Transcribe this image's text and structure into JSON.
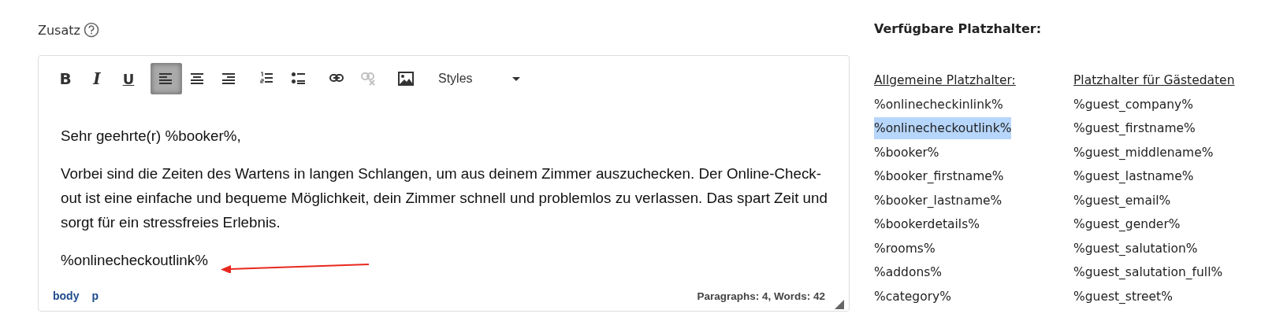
{
  "field": {
    "label": "Zusatz"
  },
  "toolbar": [
    {
      "kind": "bold",
      "label": "B",
      "selected": false,
      "disabled": false
    },
    {
      "kind": "italic",
      "label": "I",
      "selected": false,
      "disabled": false
    },
    {
      "kind": "underline",
      "label": "U",
      "selected": false,
      "disabled": false
    },
    {
      "kind": "align-left",
      "selected": true,
      "disabled": false
    },
    {
      "kind": "align-center",
      "selected": false,
      "disabled": false
    },
    {
      "kind": "align-right",
      "selected": false,
      "disabled": false
    },
    {
      "kind": "numbered-list",
      "selected": false,
      "disabled": false
    },
    {
      "kind": "bullet-list",
      "selected": false,
      "disabled": false
    },
    {
      "kind": "link",
      "selected": false,
      "disabled": false
    },
    {
      "kind": "unlink",
      "selected": false,
      "disabled": true
    },
    {
      "kind": "image",
      "selected": false,
      "disabled": false
    },
    {
      "kind": "dropdown",
      "label": "Styles",
      "selected": false,
      "disabled": false
    }
  ],
  "content": [
    "Sehr geehrte(r) %booker%,",
    "Vorbei sind die Zeiten des Wartens in langen Schlangen, um aus deinem Zimmer auszuchecken. Der Online-Check-out ist eine einfache und bequeme Möglichkeit, dein Zimmer schnell und problemlos zu verlassen. Das spart Zeit und sorgt für ein stressfreies Erlebnis.",
    "%onlinecheckoutlink%"
  ],
  "status_bar": {
    "path": [
      "body",
      "p"
    ],
    "count": "Paragraphs: 4, Words: 42"
  },
  "placeholders": {
    "title": "Verfügbare Platzhalter:",
    "columns": [
      {
        "heading": "Allgemeine Platzhalter:",
        "items": [
          {
            "text": "%onlinecheckinlink%",
            "highlighted": false
          },
          {
            "text": "%onlinecheckoutlink%",
            "highlighted": true
          },
          {
            "text": "%booker%",
            "highlighted": false
          },
          {
            "text": "%booker_firstname%",
            "highlighted": false
          },
          {
            "text": "%booker_lastname%",
            "highlighted": false
          },
          {
            "text": "%bookerdetails%",
            "highlighted": false
          },
          {
            "text": "%rooms%",
            "highlighted": false
          },
          {
            "text": "%addons%",
            "highlighted": false
          },
          {
            "text": "%category%",
            "highlighted": false
          }
        ]
      },
      {
        "heading": "Platzhalter für Gästedaten",
        "items": [
          {
            "text": "%guest_company%",
            "highlighted": false
          },
          {
            "text": "%guest_firstname%",
            "highlighted": false
          },
          {
            "text": "%guest_middlename%",
            "highlighted": false
          },
          {
            "text": "%guest_lastname%",
            "highlighted": false
          },
          {
            "text": "%guest_email%",
            "highlighted": false
          },
          {
            "text": "%guest_gender%",
            "highlighted": false
          },
          {
            "text": "%guest_salutation%",
            "highlighted": false
          },
          {
            "text": "%guest_salutation_full%",
            "highlighted": false
          },
          {
            "text": "%guest_street%",
            "highlighted": false
          }
        ]
      }
    ]
  }
}
